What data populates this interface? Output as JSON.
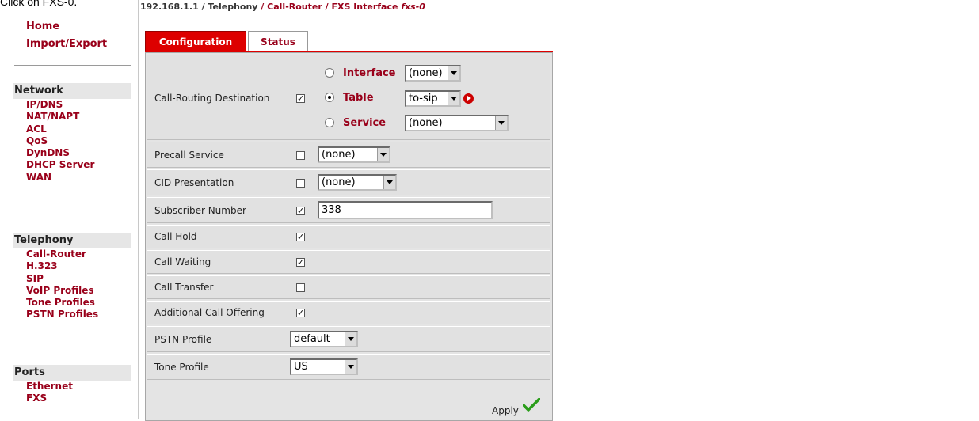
{
  "caption": "Click on FXS-0.",
  "nav": {
    "top_links": [
      "Home",
      "Import/Export"
    ],
    "sections": [
      {
        "title": "Network",
        "items": [
          "IP/DNS",
          "NAT/NAPT",
          "ACL",
          "QoS",
          "DynDNS",
          "DHCP Server",
          "WAN"
        ]
      },
      {
        "title": "Telephony",
        "items": [
          "Call-Router",
          "H.323",
          "SIP",
          "VoIP Profiles",
          "Tone Profiles",
          "PSTN Profiles"
        ]
      },
      {
        "title": "Ports",
        "items": [
          "Ethernet",
          "FXS"
        ]
      }
    ]
  },
  "breadcrumb": {
    "ip": "192.168.1.1",
    "sep1": " / ",
    "telephony": "Telephony",
    "sep2": " / ",
    "call_router": "Call-Router",
    "sep3": " / ",
    "page": "FXS Interface ",
    "iface": "fxs-0"
  },
  "tabs": {
    "configuration": "Configuration",
    "status": "Status"
  },
  "form": {
    "call_routing": {
      "label": "Call-Routing Destination",
      "checked": true,
      "options": [
        {
          "label": "Interface",
          "selected": false,
          "value": "(none)"
        },
        {
          "label": "Table",
          "selected": true,
          "value": "to-sip"
        },
        {
          "label": "Service",
          "selected": false,
          "value": "(none)"
        }
      ]
    },
    "precall": {
      "label": "Precall Service",
      "checked": false,
      "value": "(none)"
    },
    "cid": {
      "label": "CID Presentation",
      "checked": false,
      "value": "(none)"
    },
    "subscriber": {
      "label": "Subscriber Number",
      "checked": true,
      "value": "338"
    },
    "call_hold": {
      "label": "Call Hold",
      "checked": true
    },
    "call_waiting": {
      "label": "Call Waiting",
      "checked": true
    },
    "call_transfer": {
      "label": "Call Transfer",
      "checked": false
    },
    "additional_offering": {
      "label": "Additional Call Offering",
      "checked": true
    },
    "pstn_profile": {
      "label": "PSTN Profile",
      "value": "default"
    },
    "tone_profile": {
      "label": "Tone Profile",
      "value": "US"
    },
    "apply_label": "Apply"
  },
  "colors": {
    "accent": "#dd0000",
    "link": "#99001a",
    "panel": "#e4e4e4"
  }
}
